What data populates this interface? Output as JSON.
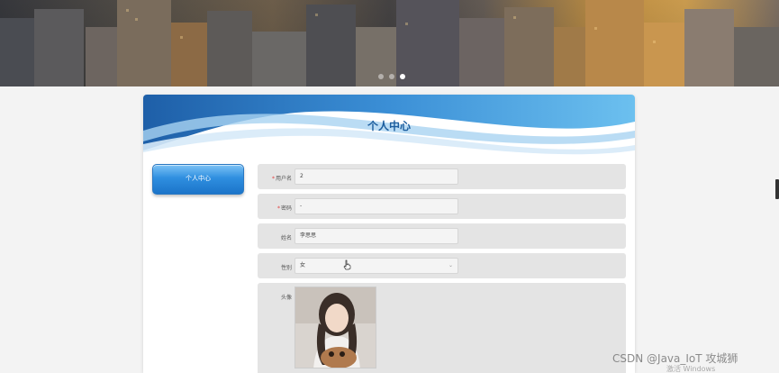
{
  "banner": {
    "image_name": "city-skyline-banner",
    "carousel_dots": 3,
    "active_dot": 2
  },
  "panel": {
    "title": "个人中心"
  },
  "sidebar": {
    "items": [
      {
        "label": "个人中心"
      }
    ]
  },
  "form": {
    "username": {
      "label": "用户名",
      "required": true,
      "value": "2"
    },
    "password": {
      "label": "密码",
      "required": true,
      "value": "-"
    },
    "name": {
      "label": "姓名",
      "required": false,
      "value": "李思思"
    },
    "gender": {
      "label": "性别",
      "required": false,
      "value": "女"
    },
    "avatar": {
      "label": "头像",
      "image_name": "user-avatar-photo"
    }
  },
  "overlay": {
    "watermark": "CSDN @Java_IoT 攻城狮",
    "activate_hint": "激活 Windows"
  },
  "colors": {
    "accent": "#1b74c9",
    "title": "#1d5e9e",
    "required": "#e03c3c"
  }
}
